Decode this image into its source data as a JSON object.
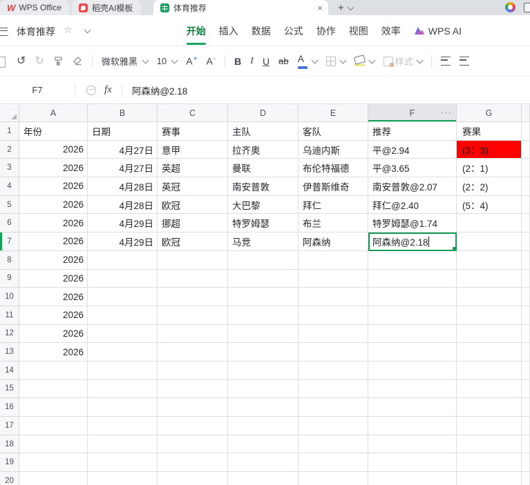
{
  "tab_bar": {
    "tabs": [
      {
        "label": "WPS Office"
      },
      {
        "label": "稻壳AI模板"
      },
      {
        "label": "体育推荐"
      }
    ],
    "close_label": "×",
    "new_tab_label": "+"
  },
  "menu_bar": {
    "doc_title": "体育推荐",
    "star": "☆",
    "items": [
      "开始",
      "插入",
      "数据",
      "公式",
      "协作",
      "视图",
      "效率",
      "WPS AI"
    ],
    "active_item": "开始"
  },
  "toolbar": {
    "undo": "↺",
    "redo": "↻",
    "font_name": "微软雅黑",
    "font_size": "10",
    "grow_font": "A",
    "grow_mark": "+",
    "shrink_font": "A",
    "shrink_mark": "-",
    "bold": "B",
    "italic": "I",
    "underline": "U",
    "strike": "ab",
    "font_color_letter": "A",
    "styles_label": "样式"
  },
  "formula_bar": {
    "cell_ref": "F7",
    "fx_label": "fx",
    "content": "阿森纳@2.18"
  },
  "sheet": {
    "col_headers": [
      "A",
      "B",
      "C",
      "D",
      "E",
      "F",
      "G"
    ],
    "selected_col": "F",
    "selected_row": 7,
    "col_menu_dots": "···",
    "rows": [
      [
        "年份",
        "日期",
        "赛事",
        "主队",
        "客队",
        "推荐",
        "赛果"
      ],
      [
        "2026",
        "4月27日",
        "意甲",
        "拉齐奥",
        "乌迪内斯",
        "平@2.94",
        "(3：3)"
      ],
      [
        "2026",
        "4月27日",
        "英超",
        "曼联",
        "布伦特福德",
        "平@3.65",
        "(2：1)"
      ],
      [
        "2026",
        "4月28日",
        "英冠",
        "南安普敦",
        "伊普斯维奇",
        "南安普敦@2.07",
        "(2：2)"
      ],
      [
        "2026",
        "4月28日",
        "欧冠",
        "大巴黎",
        "拜仁",
        "拜仁@2.40",
        "(5：4)"
      ],
      [
        "2026",
        "4月29日",
        "挪超",
        "特罗姆瑟",
        "布兰",
        "特罗姆瑟@1.74",
        ""
      ],
      [
        "2026",
        "4月29日",
        "欧冠",
        "马竞",
        "阿森纳",
        "阿森纳@2.18",
        ""
      ],
      [
        "2026",
        "",
        "",
        "",
        "",
        "",
        ""
      ],
      [
        "2026",
        "",
        "",
        "",
        "",
        "",
        ""
      ],
      [
        "2026",
        "",
        "",
        "",
        "",
        "",
        ""
      ],
      [
        "2026",
        "",
        "",
        "",
        "",
        "",
        ""
      ],
      [
        "2026",
        "",
        "",
        "",
        "",
        "",
        ""
      ],
      [
        "2026",
        "",
        "",
        "",
        "",
        "",
        ""
      ],
      [
        "",
        "",
        "",
        "",
        "",
        "",
        ""
      ],
      [
        "",
        "",
        "",
        "",
        "",
        "",
        ""
      ],
      [
        "",
        "",
        "",
        "",
        "",
        "",
        ""
      ],
      [
        "",
        "",
        "",
        "",
        "",
        "",
        ""
      ],
      [
        "",
        "",
        "",
        "",
        "",
        "",
        ""
      ],
      [
        "",
        "",
        "",
        "",
        "",
        "",
        ""
      ],
      [
        "",
        "",
        "",
        "",
        "",
        "",
        ""
      ]
    ],
    "editing_cell": {
      "ref": "F7",
      "text": "阿森纳@2.18"
    },
    "red_result_cell": {
      "ref": "G2"
    }
  },
  "colors": {
    "selection_green": "#129b53",
    "active_menu_green": "#0e7c3f",
    "result_red": "#ff0000"
  }
}
